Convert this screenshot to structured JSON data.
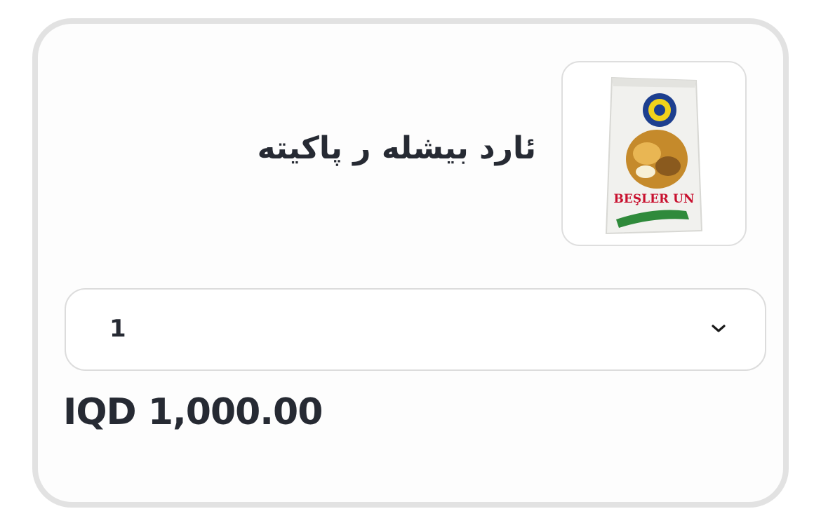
{
  "product": {
    "name": "ئارد بیشله ر پاکیته",
    "image_brand_text": "BEŞLER UN",
    "image_alt": "product-image"
  },
  "quantity": {
    "selected": "1"
  },
  "price": {
    "text": "IQD 1,000.00"
  },
  "colors": {
    "text": "#262a33",
    "card_border": "#e2e2e2",
    "field_border": "#dcdcdc",
    "brand_red": "#c8102e"
  },
  "icons": {
    "dropdown": "chevron-down-icon"
  }
}
